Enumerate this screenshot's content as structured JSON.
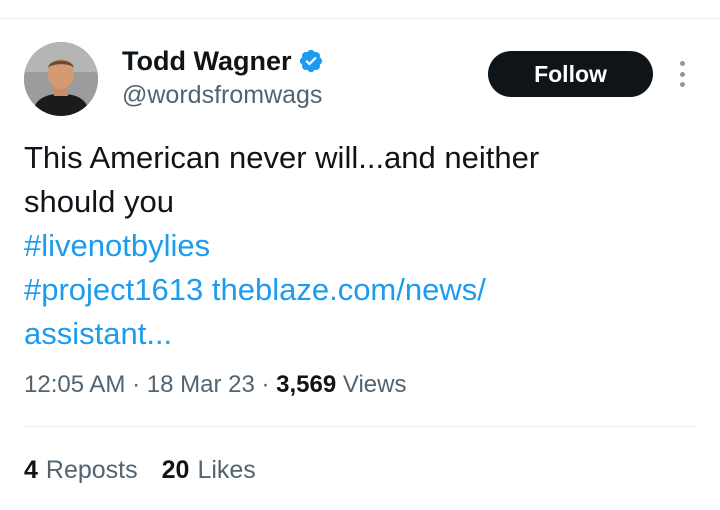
{
  "author": {
    "display_name": "Todd Wagner",
    "handle": "@wordsfromwags",
    "verified": true
  },
  "follow_button": {
    "label": "Follow"
  },
  "tweet": {
    "text_line_1": "This American never will...and neither",
    "text_line_2": "should you",
    "hashtag_1": "#livenotbylies",
    "hashtag_2": "#project1613",
    "link_line_1": "theblaze.com/news/",
    "link_line_2": "assistant..."
  },
  "meta": {
    "time": "12:05 AM",
    "separator": "·",
    "date": "18 Mar 23",
    "views_count": "3,569",
    "views_label": "Views"
  },
  "stats": {
    "reposts_count": "4",
    "reposts_label": "Reposts",
    "likes_count": "20",
    "likes_label": "Likes"
  },
  "colors": {
    "link": "#1d9bf0",
    "secondary_text": "#536471",
    "primary_text": "#0f1419",
    "follow_bg": "#0f1419",
    "divider": "#e6ecf0"
  },
  "icons": {
    "verified": "verified-badge-icon",
    "more": "more-options-icon"
  }
}
